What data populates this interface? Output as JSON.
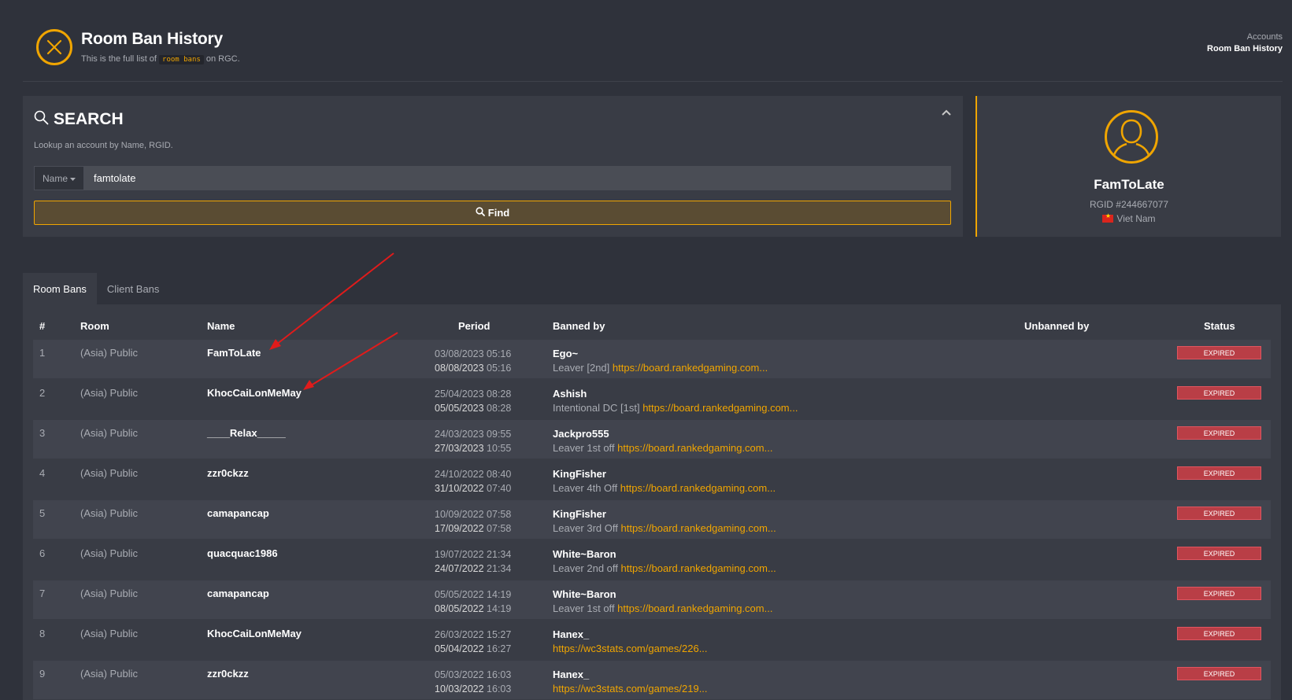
{
  "header": {
    "title": "Room Ban History",
    "subtitle_prefix": "This is the full list of",
    "subtitle_code": "room bans",
    "subtitle_suffix": "on RGC.",
    "icon": "close-circle-icon"
  },
  "breadcrumb": {
    "parent": "Accounts",
    "current": "Room Ban History"
  },
  "search": {
    "title": "SEARCH",
    "hint": "Lookup an account by Name, RGID.",
    "field_label": "Name",
    "value": "famtolate",
    "find_label": "Find"
  },
  "profile": {
    "name": "FamToLate",
    "rgid": "RGID #244667077",
    "country": "Viet Nam"
  },
  "tabs": [
    {
      "label": "Room Bans",
      "active": true
    },
    {
      "label": "Client Bans",
      "active": false
    }
  ],
  "table": {
    "columns": {
      "num": "#",
      "room": "Room",
      "name": "Name",
      "period": "Period",
      "banned_by": "Banned by",
      "unbanned_by": "Unbanned by",
      "status": "Status"
    },
    "rows": [
      {
        "num": "1",
        "room": "(Asia) Public",
        "name": "FamToLate",
        "start_date": "03/08/2023",
        "start_time": "05:16",
        "end_date": "08/08/2023",
        "end_time": "05:16",
        "banned_by": "Ego~",
        "reason": "Leaver [2nd]",
        "link": "https://board.rankedgaming.com...",
        "status": "EXPIRED"
      },
      {
        "num": "2",
        "room": "(Asia) Public",
        "name": "KhocCaiLonMeMay",
        "start_date": "25/04/2023",
        "start_time": "08:28",
        "end_date": "05/05/2023",
        "end_time": "08:28",
        "banned_by": "Ashish",
        "reason": "Intentional DC [1st]",
        "link": "https://board.rankedgaming.com...",
        "status": "EXPIRED"
      },
      {
        "num": "3",
        "room": "(Asia) Public",
        "name": "____Relax_____",
        "start_date": "24/03/2023",
        "start_time": "09:55",
        "end_date": "27/03/2023",
        "end_time": "10:55",
        "banned_by": "Jackpro555",
        "reason": "Leaver 1st off",
        "link": "https://board.rankedgaming.com...",
        "status": "EXPIRED"
      },
      {
        "num": "4",
        "room": "(Asia) Public",
        "name": "zzr0ckzz",
        "start_date": "24/10/2022",
        "start_time": "08:40",
        "end_date": "31/10/2022",
        "end_time": "07:40",
        "banned_by": "KingFisher",
        "reason": "Leaver 4th Off",
        "link": "https://board.rankedgaming.com...",
        "status": "EXPIRED"
      },
      {
        "num": "5",
        "room": "(Asia) Public",
        "name": "camapancap",
        "start_date": "10/09/2022",
        "start_time": "07:58",
        "end_date": "17/09/2022",
        "end_time": "07:58",
        "banned_by": "KingFisher",
        "reason": "Leaver 3rd Off",
        "link": "https://board.rankedgaming.com...",
        "status": "EXPIRED"
      },
      {
        "num": "6",
        "room": "(Asia) Public",
        "name": "quacquac1986",
        "start_date": "19/07/2022",
        "start_time": "21:34",
        "end_date": "24/07/2022",
        "end_time": "21:34",
        "banned_by": "White~Baron",
        "reason": "Leaver 2nd off",
        "link": "https://board.rankedgaming.com...",
        "status": "EXPIRED"
      },
      {
        "num": "7",
        "room": "(Asia) Public",
        "name": "camapancap",
        "start_date": "05/05/2022",
        "start_time": "14:19",
        "end_date": "08/05/2022",
        "end_time": "14:19",
        "banned_by": "White~Baron",
        "reason": "Leaver 1st off",
        "link": "https://board.rankedgaming.com...",
        "status": "EXPIRED"
      },
      {
        "num": "8",
        "room": "(Asia) Public",
        "name": "KhocCaiLonMeMay",
        "start_date": "26/03/2022",
        "start_time": "15:27",
        "end_date": "05/04/2022",
        "end_time": "16:27",
        "banned_by": "Hanex_",
        "reason": "",
        "link": "https://wc3stats.com/games/226...",
        "status": "EXPIRED"
      },
      {
        "num": "9",
        "room": "(Asia) Public",
        "name": "zzr0ckzz",
        "start_date": "05/03/2022",
        "start_time": "16:03",
        "end_date": "10/03/2022",
        "end_time": "16:03",
        "banned_by": "Hanex_",
        "reason": "",
        "link": "https://wc3stats.com/games/219...",
        "status": "EXPIRED"
      }
    ]
  },
  "colors": {
    "accent": "#f0a500",
    "background": "#2f323b",
    "panel": "#393c45",
    "expired": "#b93e46",
    "annotation_arrow": "#e01b1b"
  }
}
